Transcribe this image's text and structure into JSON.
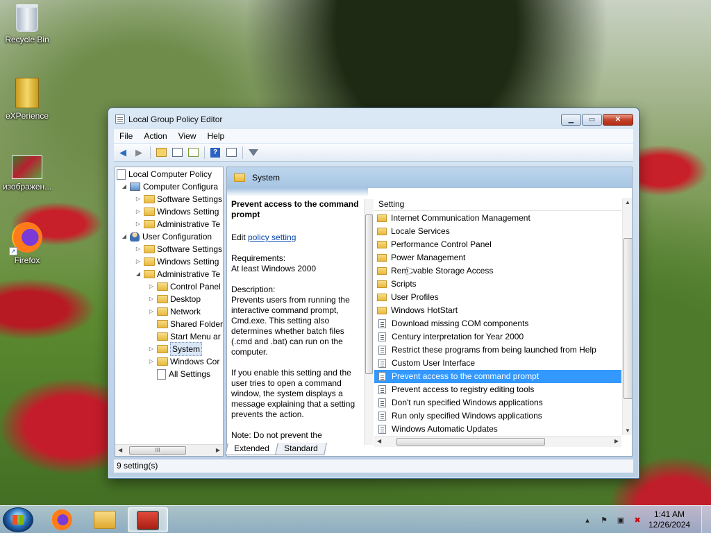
{
  "desktop": {
    "icons": [
      {
        "label": "Recycle Bin",
        "icon": "recycle-bin-icon"
      },
      {
        "label": "eXPerience",
        "icon": "folder-icon"
      },
      {
        "label": "изображен...",
        "icon": "image-file-icon"
      },
      {
        "label": "Firefox",
        "icon": "firefox-icon"
      }
    ]
  },
  "window": {
    "title": "Local Group Policy Editor",
    "caption_min": "▁",
    "caption_max": "▭",
    "caption_close": "✕",
    "menu": [
      "File",
      "Action",
      "View",
      "Help"
    ],
    "tree": [
      {
        "label": "Local Computer Policy",
        "icon": "doc"
      },
      {
        "label": "Computer Configura",
        "icon": "comp",
        "arrow": "◢"
      },
      {
        "label": "Software Settings",
        "icon": "folder",
        "arrow": "▷"
      },
      {
        "label": "Windows Setting",
        "icon": "folder",
        "arrow": "▷"
      },
      {
        "label": "Administrative Te",
        "icon": "folder",
        "arrow": "▷"
      },
      {
        "label": "User Configuration",
        "icon": "user",
        "arrow": "◢"
      },
      {
        "label": "Software Settings",
        "icon": "folder",
        "arrow": "▷"
      },
      {
        "label": "Windows Setting",
        "icon": "folder",
        "arrow": "▷"
      },
      {
        "label": "Administrative Te",
        "icon": "folder",
        "arrow": "◢"
      },
      {
        "label": "Control Panel",
        "icon": "folder",
        "arrow": "▷"
      },
      {
        "label": "Desktop",
        "icon": "folder",
        "arrow": "▷"
      },
      {
        "label": "Network",
        "icon": "folder",
        "arrow": "▷"
      },
      {
        "label": "Shared Folder",
        "icon": "folder",
        "arrow": ""
      },
      {
        "label": "Start Menu ar",
        "icon": "folder",
        "arrow": ""
      },
      {
        "label": "System",
        "icon": "folder",
        "arrow": "▷",
        "selected": true
      },
      {
        "label": "Windows Cor",
        "icon": "folder",
        "arrow": "▷"
      },
      {
        "label": "All Settings",
        "icon": "doc",
        "arrow": ""
      }
    ],
    "tree_scroll_thumb": "III",
    "header_title": "System",
    "description": {
      "heading": "Prevent access to the command prompt",
      "edit_prefix": "Edit ",
      "edit_link": "policy setting",
      "requirements_label": "Requirements:",
      "requirements_value": "At least Windows 2000",
      "description_label": "Description:",
      "description_text": "Prevents users from running the interactive command prompt, Cmd.exe. This setting also determines whether batch files (.cmd and .bat) can run on the computer.",
      "para2": "If you enable this setting and the user tries to open a command window, the system displays a message explaining that a setting prevents the action.",
      "note": "Note: Do not prevent the"
    },
    "list_header": "Setting",
    "list": [
      {
        "label": "Internet Communication Management",
        "type": "folder"
      },
      {
        "label": "Locale Services",
        "type": "folder"
      },
      {
        "label": "Performance Control Panel",
        "type": "folder"
      },
      {
        "label": "Power Management",
        "type": "folder"
      },
      {
        "label": "Removable Storage Access",
        "type": "folder"
      },
      {
        "label": "Scripts",
        "type": "folder"
      },
      {
        "label": "User Profiles",
        "type": "folder"
      },
      {
        "label": "Windows HotStart",
        "type": "folder"
      },
      {
        "label": "Download missing COM components",
        "type": "policy"
      },
      {
        "label": "Century interpretation for Year 2000",
        "type": "policy"
      },
      {
        "label": "Restrict these programs from being launched from Help",
        "type": "policy"
      },
      {
        "label": "Custom User Interface",
        "type": "policy"
      },
      {
        "label": "Prevent access to the command prompt",
        "type": "policy",
        "selected": true
      },
      {
        "label": "Prevent access to registry editing tools",
        "type": "policy"
      },
      {
        "label": "Don't run specified Windows applications",
        "type": "policy"
      },
      {
        "label": "Run only specified Windows applications",
        "type": "policy"
      },
      {
        "label": "Windows Automatic Updates",
        "type": "policy"
      }
    ],
    "tabs": [
      "Extended",
      "Standard"
    ],
    "status": "9 setting(s)"
  },
  "taskbar": {
    "apps": [
      {
        "name": "firefox",
        "icon": "firefox-icon"
      },
      {
        "name": "windows-explorer",
        "icon": "explorer-icon"
      },
      {
        "name": "group-policy-editor",
        "icon": "gpedit-icon",
        "active": true
      }
    ],
    "tray_arrow": "▴",
    "time": "1:41 AM",
    "date": "12/26/2024"
  }
}
